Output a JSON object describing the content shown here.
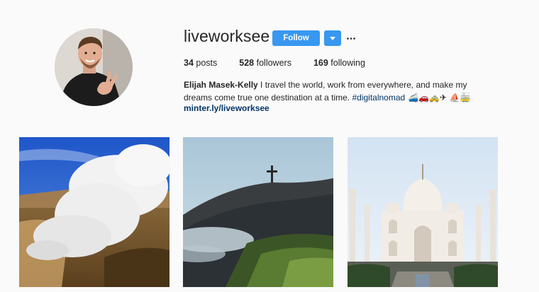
{
  "profile": {
    "username": "liveworksee",
    "follow_label": "Follow",
    "dropdown_icon": "caret-down-icon",
    "more_icon": "ellipsis-icon"
  },
  "stats": {
    "posts": {
      "count": "34",
      "label": "posts"
    },
    "followers": {
      "count": "528",
      "label": "followers"
    },
    "following": {
      "count": "169",
      "label": "following"
    }
  },
  "bio": {
    "name": "Elijah Masek-Kelly",
    "text": " I travel the world, work from everywhere, and make my dreams come true one destination at a time. ",
    "hashtag": "#digitalnomad",
    "emojis": " 🚄🚗🚕✈ ⛵🚋",
    "link": "minter.ly/liveworksee"
  },
  "colors": {
    "accent": "#3897f0",
    "link": "#003569",
    "background": "#fafafa",
    "text": "#262626"
  },
  "posts": [
    {
      "icon": "geyser-steam-photo"
    },
    {
      "icon": "hill-with-cross-photo"
    },
    {
      "icon": "taj-mahal-photo"
    }
  ]
}
